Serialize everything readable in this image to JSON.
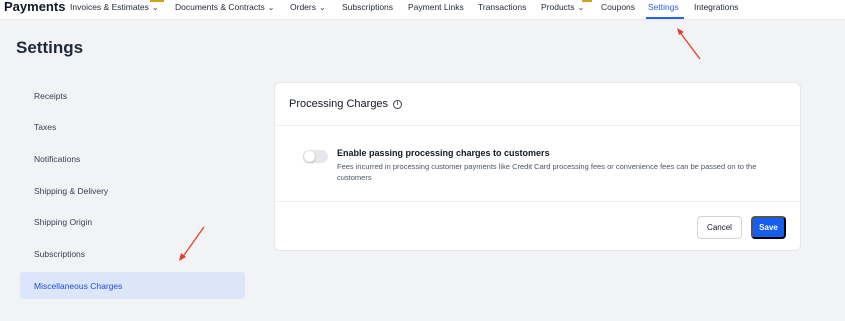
{
  "app": {
    "title": "Payments"
  },
  "nav": {
    "items": [
      {
        "label": "Invoices & Estimates",
        "chevron": true
      },
      {
        "label": "Documents & Contracts",
        "chevron": true
      },
      {
        "label": "Orders",
        "chevron": true
      },
      {
        "label": "Subscriptions",
        "chevron": false
      },
      {
        "label": "Payment Links",
        "chevron": false
      },
      {
        "label": "Transactions",
        "chevron": false
      },
      {
        "label": "Products",
        "chevron": true
      },
      {
        "label": "Coupons",
        "chevron": false
      },
      {
        "label": "Settings",
        "chevron": false,
        "active": true
      },
      {
        "label": "Integrations",
        "chevron": false
      }
    ]
  },
  "page": {
    "title": "Settings"
  },
  "sidebar": {
    "items": [
      {
        "label": "Receipts"
      },
      {
        "label": "Taxes"
      },
      {
        "label": "Notifications"
      },
      {
        "label": "Shipping & Delivery"
      },
      {
        "label": "Shipping Origin"
      },
      {
        "label": "Subscriptions"
      },
      {
        "label": "Miscellaneous Charges",
        "active": true
      }
    ]
  },
  "card": {
    "title": "Processing Charges",
    "info_icon": "info-icon",
    "toggle": {
      "enabled": false
    },
    "setting_label": "Enable passing processing charges to customers",
    "setting_description": "Fees incurred in processing customer payments like Credit Card processing fees or convenience fees can be passed on to the customers",
    "cancel_label": "Cancel",
    "save_label": "Save"
  },
  "colors": {
    "accent": "#2563eb",
    "save_button": "#155eef",
    "active_sidebar_bg": "#dbe6fb",
    "annotation_arrow": "#e53e2e"
  }
}
